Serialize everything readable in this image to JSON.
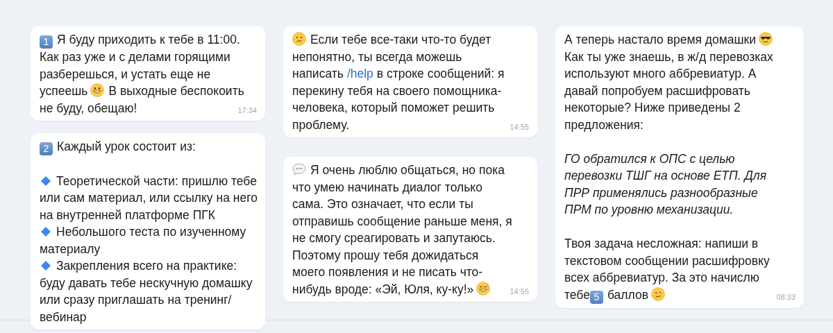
{
  "columns": [
    {
      "messages": [
        {
          "blocks": [
            [
              [
                {
                  "kind": "keycap",
                  "text": "1"
                },
                {
                  "kind": "text",
                  "text": "Я буду приходить к тебе в 11:00."
                }
              ],
              [
                {
                  "kind": "text",
                  "text": "Как раз уже и с делами горящими"
                }
              ],
              [
                {
                  "kind": "text",
                  "text": "разберешься, и устать еще не"
                }
              ],
              [
                {
                  "kind": "text",
                  "text": "успеешь"
                },
                {
                  "kind": "emoji-grin"
                },
                {
                  "kind": "text",
                  "text": "В выходные беспокоить"
                }
              ],
              [
                {
                  "kind": "text",
                  "text": "не буду, обещаю!"
                }
              ]
            ]
          ],
          "time": "17:34"
        },
        {
          "blocks": [
            [
              [
                {
                  "kind": "keycap",
                  "text": "2"
                },
                {
                  "kind": "text",
                  "text": "Каждый урок состоит из:"
                }
              ]
            ],
            [
              [
                {
                  "kind": "emoji-diamond"
                },
                {
                  "kind": "text",
                  "text": "Теоретической части: пришлю тебе"
                }
              ],
              [
                {
                  "kind": "text",
                  "text": "или сам материал, или ссылку на него"
                }
              ],
              [
                {
                  "kind": "text",
                  "text": "на внутренней платформе ПГК"
                }
              ],
              [
                {
                  "kind": "emoji-diamond"
                },
                {
                  "kind": "text",
                  "text": "Небольшого теста по изученному"
                }
              ],
              [
                {
                  "kind": "text",
                  "text": "материалу"
                }
              ],
              [
                {
                  "kind": "emoji-diamond"
                },
                {
                  "kind": "text",
                  "text": "Закрепления всего на практике:"
                }
              ],
              [
                {
                  "kind": "text",
                  "text": "буду давать тебе нескучную домашку"
                }
              ],
              [
                {
                  "kind": "text",
                  "text": "или сразу приглашать на тренинг/"
                }
              ],
              [
                {
                  "kind": "text",
                  "text": "вебинар"
                }
              ]
            ]
          ]
        }
      ]
    },
    {
      "messages": [
        {
          "blocks": [
            [
              [
                {
                  "kind": "emoji-confused"
                },
                {
                  "kind": "text",
                  "text": "Если тебе все-таки что-то будет"
                }
              ],
              [
                {
                  "kind": "text",
                  "text": "непонятно, ты всегда можешь"
                }
              ],
              [
                {
                  "kind": "text",
                  "text": "написать"
                },
                {
                  "kind": "link",
                  "text": "/help"
                },
                {
                  "kind": "text",
                  "text": "в строке сообщений: я"
                }
              ],
              [
                {
                  "kind": "text",
                  "text": "перекину тебя на своего помощника-"
                }
              ],
              [
                {
                  "kind": "text",
                  "text": "человека, который поможет решить"
                }
              ],
              [
                {
                  "kind": "text",
                  "text": "проблему."
                }
              ]
            ]
          ],
          "time": "14:55"
        },
        {
          "blocks": [
            [
              [
                {
                  "kind": "emoji-speech"
                },
                {
                  "kind": "text",
                  "text": "Я очень люблю общаться, но пока"
                }
              ],
              [
                {
                  "kind": "text",
                  "text": "что умею начинать диалог только"
                }
              ],
              [
                {
                  "kind": "text",
                  "text": "сама. Это означает, что если ты"
                }
              ],
              [
                {
                  "kind": "text",
                  "text": "отправишь сообщение раньше меня, я"
                }
              ],
              [
                {
                  "kind": "text",
                  "text": "не смогу среагировать и запутаюсь."
                }
              ],
              [
                {
                  "kind": "text",
                  "text": "Поэтому прошу тебя дожидаться"
                }
              ],
              [
                {
                  "kind": "text",
                  "text": "моего появления и не писать что-"
                }
              ],
              [
                {
                  "kind": "text",
                  "text": "нибудь вроде: «Эй, Юля, ку-ку!»"
                },
                {
                  "kind": "emoji-sweat"
                }
              ]
            ]
          ],
          "time": "14:55"
        }
      ]
    },
    {
      "messages": [
        {
          "blocks": [
            [
              [
                {
                  "kind": "text",
                  "text": "А теперь настало время домашки"
                },
                {
                  "kind": "emoji-cool"
                }
              ],
              [
                {
                  "kind": "text",
                  "text": "Как ты уже знаешь, в ж/д перевозках"
                }
              ],
              [
                {
                  "kind": "text",
                  "text": "используют много аббревиатур. А"
                }
              ],
              [
                {
                  "kind": "text",
                  "text": "давай попробуем расшифровать"
                }
              ],
              [
                {
                  "kind": "text",
                  "text": "некоторые? Ниже приведены 2"
                }
              ],
              [
                {
                  "kind": "text",
                  "text": "предложения:"
                }
              ]
            ],
            [
              [
                {
                  "kind": "italic",
                  "text": "ГО обратился к ОПС с целью"
                }
              ],
              [
                {
                  "kind": "italic",
                  "text": "перевозки ТШГ на основе ЕТП. Для"
                }
              ],
              [
                {
                  "kind": "italic",
                  "text": "ПРР применялись разнообразные"
                }
              ],
              [
                {
                  "kind": "italic",
                  "text": "ПРМ по уровню механизации."
                }
              ]
            ],
            [
              [
                {
                  "kind": "text",
                  "text": "Твоя задача несложная: напиши в"
                }
              ],
              [
                {
                  "kind": "text",
                  "text": "текстовом сообщении расшифровку"
                }
              ],
              [
                {
                  "kind": "text",
                  "text": "всех аббревиатур. За это начислю"
                }
              ],
              [
                {
                  "kind": "text",
                  "text": "тебе"
                },
                {
                  "kind": "keycap",
                  "text": "5"
                },
                {
                  "kind": "text",
                  "text": "баллов"
                },
                {
                  "kind": "emoji-wink"
                }
              ]
            ]
          ],
          "time": "08:33"
        }
      ]
    }
  ]
}
